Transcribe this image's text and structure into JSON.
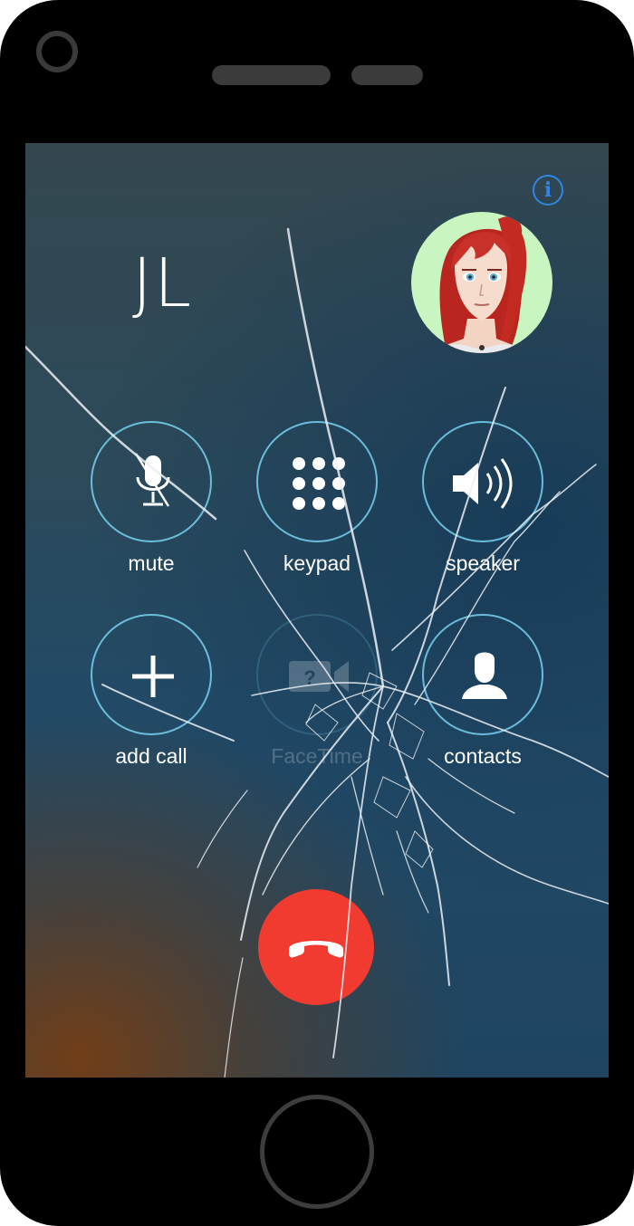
{
  "call": {
    "caller_name": "JL",
    "info_label": "i"
  },
  "controls": [
    {
      "label": "mute",
      "icon": "microphone-muted-icon"
    },
    {
      "label": "keypad",
      "icon": "keypad-icon"
    },
    {
      "label": "speaker",
      "icon": "speaker-icon"
    },
    {
      "label": "add call",
      "icon": "plus-icon"
    },
    {
      "label": "FaceTime",
      "icon": "facetime-icon"
    },
    {
      "label": "contacts",
      "icon": "contacts-icon"
    }
  ],
  "end_call": {
    "icon": "end-call-icon",
    "color": "#f23b30"
  },
  "theme": {
    "accent": "#2f86e4",
    "ring": "#78d2f0",
    "screen_dark": "#224a66"
  }
}
